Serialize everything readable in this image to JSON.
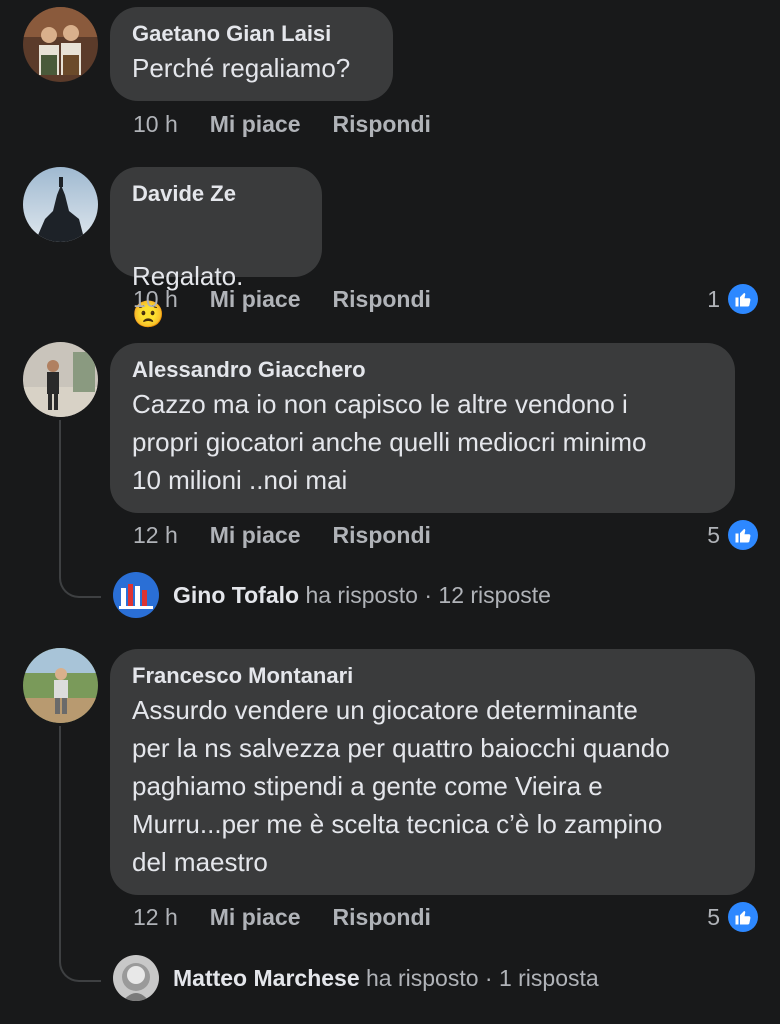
{
  "comments": [
    {
      "author": "Gaetano Gian Laisi",
      "text": "Perché regaliamo?",
      "time": "10 h",
      "like_label": "Mi piace",
      "reply_label": "Rispondi"
    },
    {
      "author": "Davide Ze",
      "text": "Regalato.",
      "emoji": "😟",
      "time": "10 h",
      "like_label": "Mi piace",
      "reply_label": "Rispondi",
      "likes": "1"
    },
    {
      "author": "Alessandro Giacchero",
      "text": "Cazzo ma io non capisco le altre vendono i\npropri giocatori anche quelli mediocri minimo\n10 milioni ..noi mai",
      "time": "12 h",
      "like_label": "Mi piace",
      "reply_label": "Rispondi",
      "likes": "5",
      "reply": {
        "name": "Gino Tofalo",
        "action": "ha risposto",
        "count": "· 12 risposte"
      }
    },
    {
      "author": "Francesco Montanari",
      "text": "Assurdo vendere un giocatore determinante\nper la ns salvezza per quattro baiocchi quando\npaghiamo stipendi a gente come Vieira e\nMurru...per me è scelta tecnica c’è lo zampino\ndel maestro",
      "time": "12 h",
      "like_label": "Mi piace",
      "reply_label": "Rispondi",
      "likes": "5",
      "reply": {
        "name": "Matteo Marchese",
        "action": "ha risposto",
        "count": "· 1 risposta"
      }
    }
  ],
  "colors": {
    "background": "#18191a",
    "bubble": "#3a3b3c",
    "like_blue": "#2d88ff",
    "secondary_text": "#b0b3b8"
  },
  "icons": [
    "thumbs-up-icon"
  ]
}
